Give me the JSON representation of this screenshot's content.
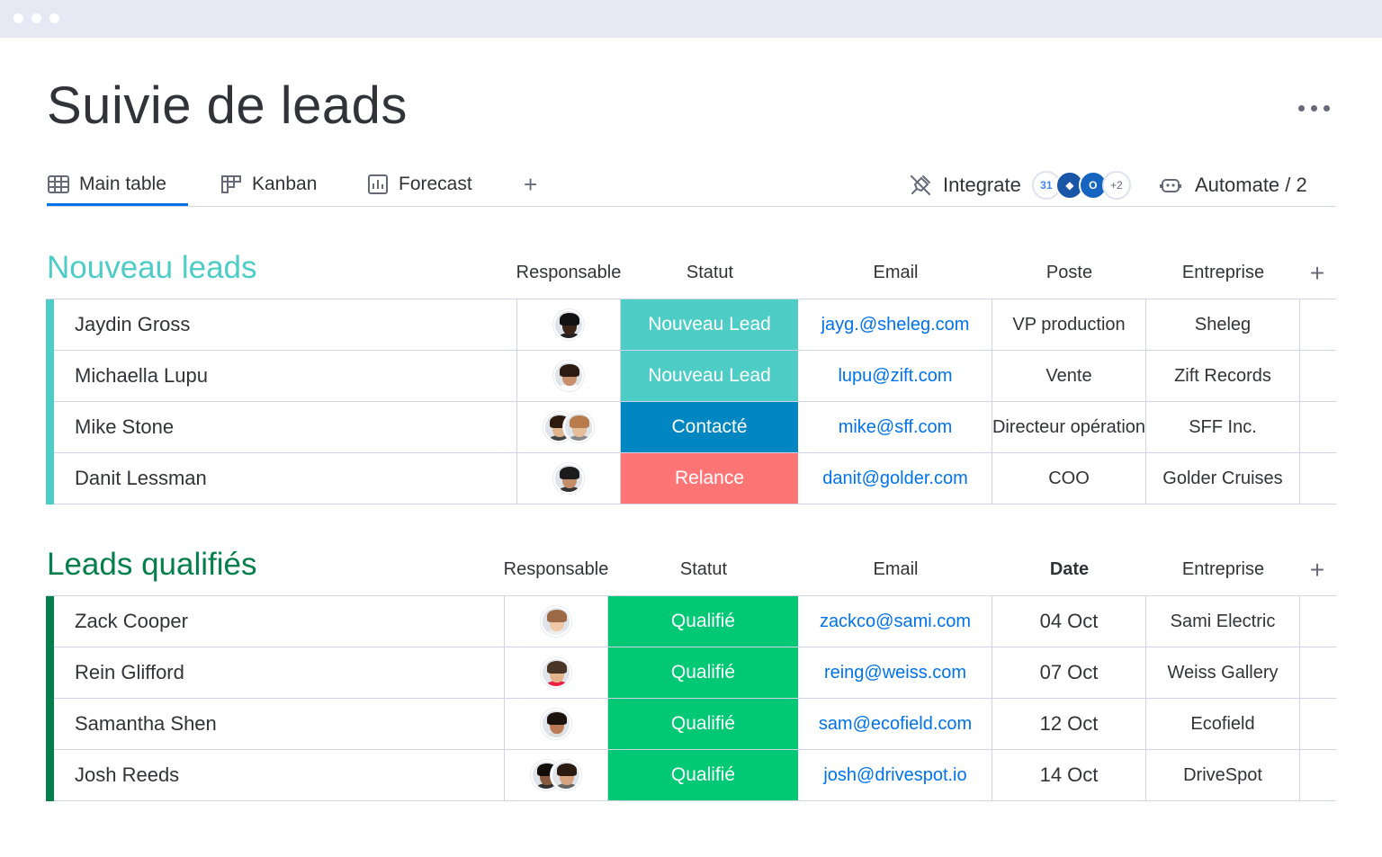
{
  "page": {
    "title": "Suivie de leads"
  },
  "tabs": [
    {
      "label": "Main table",
      "icon": "table-icon"
    },
    {
      "label": "Kanban",
      "icon": "kanban-icon"
    },
    {
      "label": "Forecast",
      "icon": "chart-icon"
    }
  ],
  "toolbar": {
    "integrate_label": "Integrate",
    "integrations_more": "+2",
    "automate_label": "Automate / 2"
  },
  "groups": [
    {
      "title": "Nouveau leads",
      "color": "#4eccc6",
      "columns": [
        "Responsable",
        "Statut",
        "Email",
        "Poste",
        "Entreprise"
      ],
      "rows": [
        {
          "name": "Jaydin Gross",
          "status": "Nouveau Lead",
          "status_color": "#4eccc6",
          "email": "jayg.@sheleg.com",
          "col4": "VP production",
          "company": "Sheleg"
        },
        {
          "name": "Michaella Lupu",
          "status": "Nouveau Lead",
          "status_color": "#4eccc6",
          "email": "lupu@zift.com",
          "col4": "Vente",
          "company": "Zift Records"
        },
        {
          "name": "Mike Stone",
          "status": "Contacté",
          "status_color": "#0086c0",
          "email": "mike@sff.com",
          "col4": "Directeur opération",
          "company": "SFF Inc."
        },
        {
          "name": "Danit Lessman",
          "status": "Relance",
          "status_color": "#ff7575",
          "email": "danit@golder.com",
          "col4": "COO",
          "company": "Golder Cruises"
        }
      ]
    },
    {
      "title": "Leads qualifiés",
      "color": "#037f4c",
      "columns": [
        "Responsable",
        "Statut",
        "Email",
        "Date",
        "Entreprise"
      ],
      "rows": [
        {
          "name": "Zack Cooper",
          "status": "Qualifié",
          "status_color": "#00c875",
          "email": "zackco@sami.com",
          "col4": "04 Oct",
          "company": "Sami Electric"
        },
        {
          "name": "Rein Glifford",
          "status": "Qualifié",
          "status_color": "#00c875",
          "email": "reing@weiss.com",
          "col4": "07 Oct",
          "company": "Weiss Gallery"
        },
        {
          "name": "Samantha Shen",
          "status": "Qualifié",
          "status_color": "#00c875",
          "email": "sam@ecofield.com",
          "col4": "12 Oct",
          "company": "Ecofield"
        },
        {
          "name": "Josh Reeds",
          "status": "Qualifié",
          "status_color": "#00c875",
          "email": "josh@drivespot.io",
          "col4": "14 Oct",
          "company": "DriveSpot"
        }
      ]
    }
  ]
}
